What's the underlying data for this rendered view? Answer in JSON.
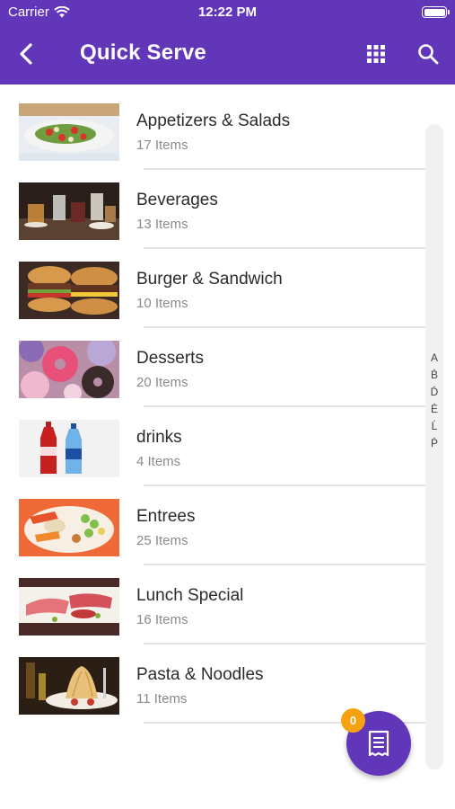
{
  "status_bar": {
    "carrier": "Carrier",
    "time": "12:22 PM",
    "icons": [
      "wifi-icon",
      "battery-icon"
    ]
  },
  "header": {
    "title": "Quick Serve",
    "back_icon": "chevron-left-icon",
    "grid_icon": "grid-icon",
    "search_icon": "search-icon",
    "background_color": "#6236b8"
  },
  "categories": [
    {
      "name": "Appetizers & Salads",
      "count": "17 Items",
      "image": "appetizers-image"
    },
    {
      "name": "Beverages",
      "count": "13 Items",
      "image": "beverages-image"
    },
    {
      "name": "Burger & Sandwich",
      "count": "10 Items",
      "image": "burger-image"
    },
    {
      "name": "Desserts",
      "count": "20 Items",
      "image": "donuts-image"
    },
    {
      "name": "drinks",
      "count": "4 Items",
      "image": "soda-bottles-image"
    },
    {
      "name": "Entrees",
      "count": "25 Items",
      "image": "entree-platter-image"
    },
    {
      "name": "Lunch Special",
      "count": "16 Items",
      "image": "sushi-image"
    },
    {
      "name": "Pasta & Noodles",
      "count": "11 Items",
      "image": "pasta-image"
    }
  ],
  "index_bar": {
    "letters": [
      "A",
      ".",
      "B",
      ".",
      "D",
      ".",
      "E",
      ".",
      "L",
      ".",
      "P"
    ]
  },
  "cart_fab": {
    "icon": "receipt-icon",
    "badge_count": "0",
    "badge_color": "#f6a210"
  }
}
